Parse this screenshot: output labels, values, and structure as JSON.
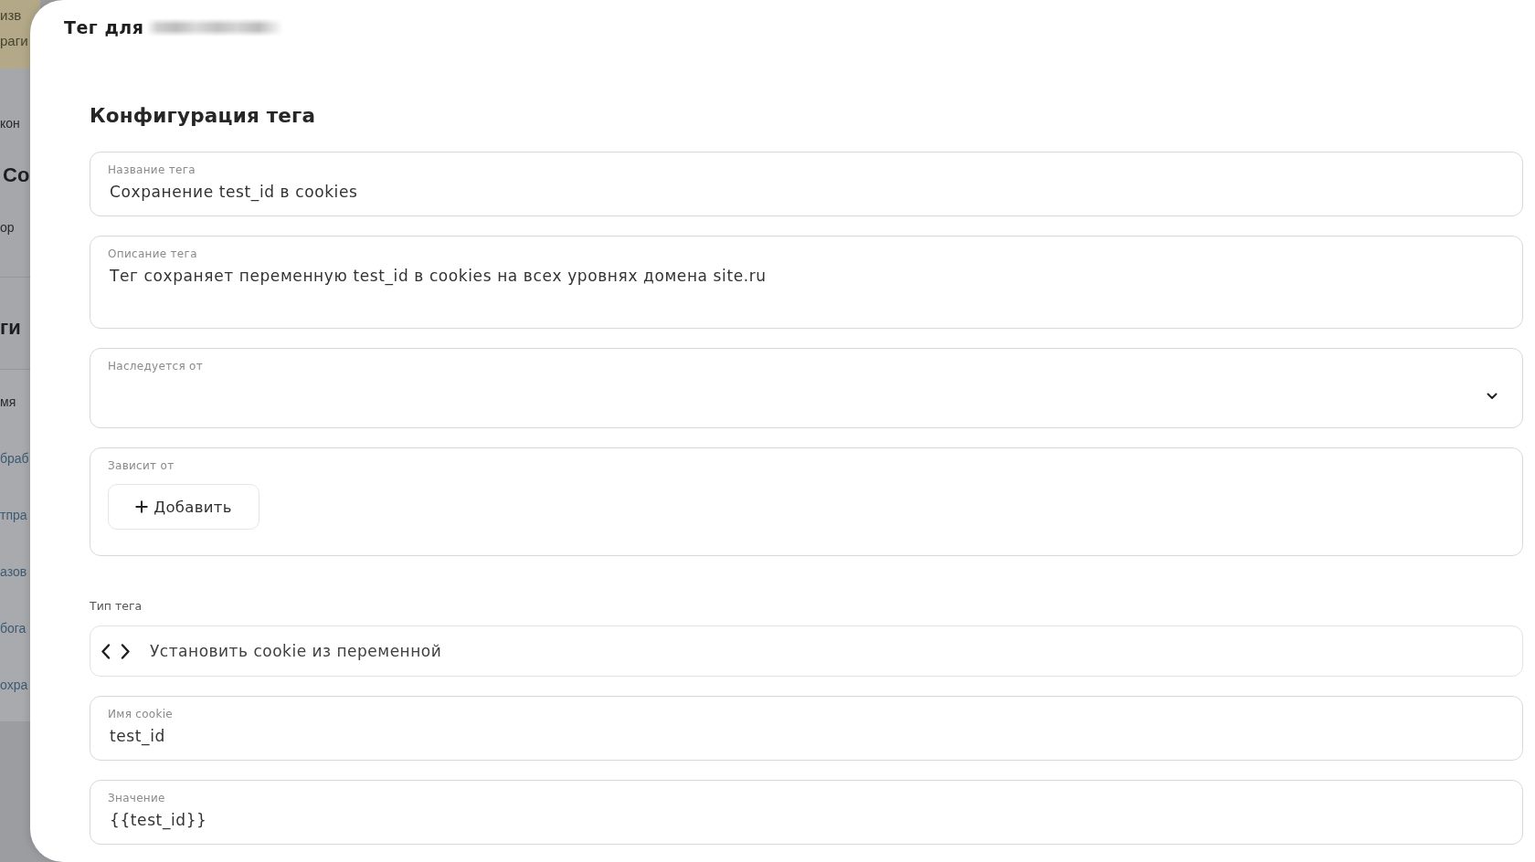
{
  "backdrop": {
    "banner": [
      "изв",
      "раги"
    ],
    "header": [
      {
        "kind": "text",
        "text": "кон"
      },
      {
        "kind": "title",
        "text": "Со"
      },
      {
        "kind": "text",
        "text": "ор"
      }
    ],
    "section_title": "ги",
    "rows": [
      {
        "kind": "text",
        "text": "мя"
      },
      {
        "kind": "link",
        "text": "браб"
      },
      {
        "kind": "link",
        "text": "тпра"
      },
      {
        "kind": "link",
        "text": "азов"
      },
      {
        "kind": "link",
        "text": "бога"
      },
      {
        "kind": "link",
        "text": "охра"
      }
    ]
  },
  "modal": {
    "title": "Тег для",
    "title_redacted": true,
    "section_title": "Конфигурация тега",
    "fields": [
      {
        "kind": "text",
        "label": "Название тега",
        "value": "Сохранение test_id в cookies"
      },
      {
        "kind": "textarea",
        "label": "Описание тега",
        "value": "Тег сохраняет переменную test_id в cookies на всех уровнях домена site.ru"
      },
      {
        "kind": "select",
        "label": "Наследуется от"
      },
      {
        "kind": "dependencies",
        "label": "Зависит от",
        "button": "Добавить"
      },
      {
        "kind": "type",
        "label": "Тип тега",
        "value": "Установить cookie из переменной"
      },
      {
        "kind": "text",
        "label": "Имя cookie",
        "value": "test_id"
      },
      {
        "kind": "text",
        "label": "Значение",
        "value": "{{test_id}}"
      }
    ]
  }
}
